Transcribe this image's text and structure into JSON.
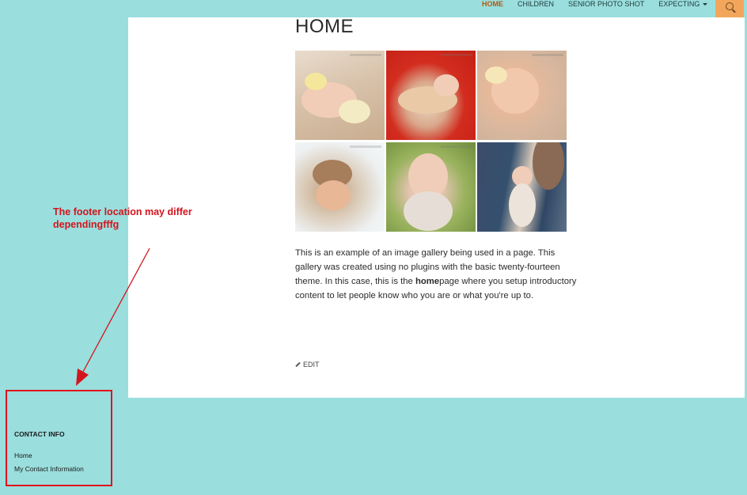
{
  "nav": {
    "items": [
      {
        "label": "HOME",
        "active": true
      },
      {
        "label": "CHILDREN",
        "active": false
      },
      {
        "label": "SENIOR PHOTO SHOT",
        "active": false
      },
      {
        "label": "EXPECTING",
        "active": false,
        "has_dropdown": true
      }
    ],
    "search_icon": "search-icon",
    "accent_color": "#f2a65b"
  },
  "page": {
    "title": "HOME",
    "description_before": "This is an example of an image gallery being used in a page.  This gallery was created using no plugins with the basic twenty-fourteen theme. In this case, this is the ",
    "description_bold": "home",
    "description_after": "page where you setup introductory content to let people know who you are or what you're up to.",
    "edit_label": "EDIT"
  },
  "gallery": {
    "photos": [
      {
        "name": "gallery-photo-1"
      },
      {
        "name": "gallery-photo-2"
      },
      {
        "name": "gallery-photo-3"
      },
      {
        "name": "gallery-photo-4"
      },
      {
        "name": "gallery-photo-5"
      },
      {
        "name": "gallery-photo-6"
      }
    ]
  },
  "annotation": {
    "text": "The footer location may differ dependingfffg",
    "color": "#d3141d"
  },
  "footer": {
    "title": "CONTACT INFO",
    "links": [
      "Home",
      "My Contact Information"
    ]
  },
  "colors": {
    "background": "#9adedd",
    "content": "#ffffff",
    "nav_active": "#b05a12"
  }
}
